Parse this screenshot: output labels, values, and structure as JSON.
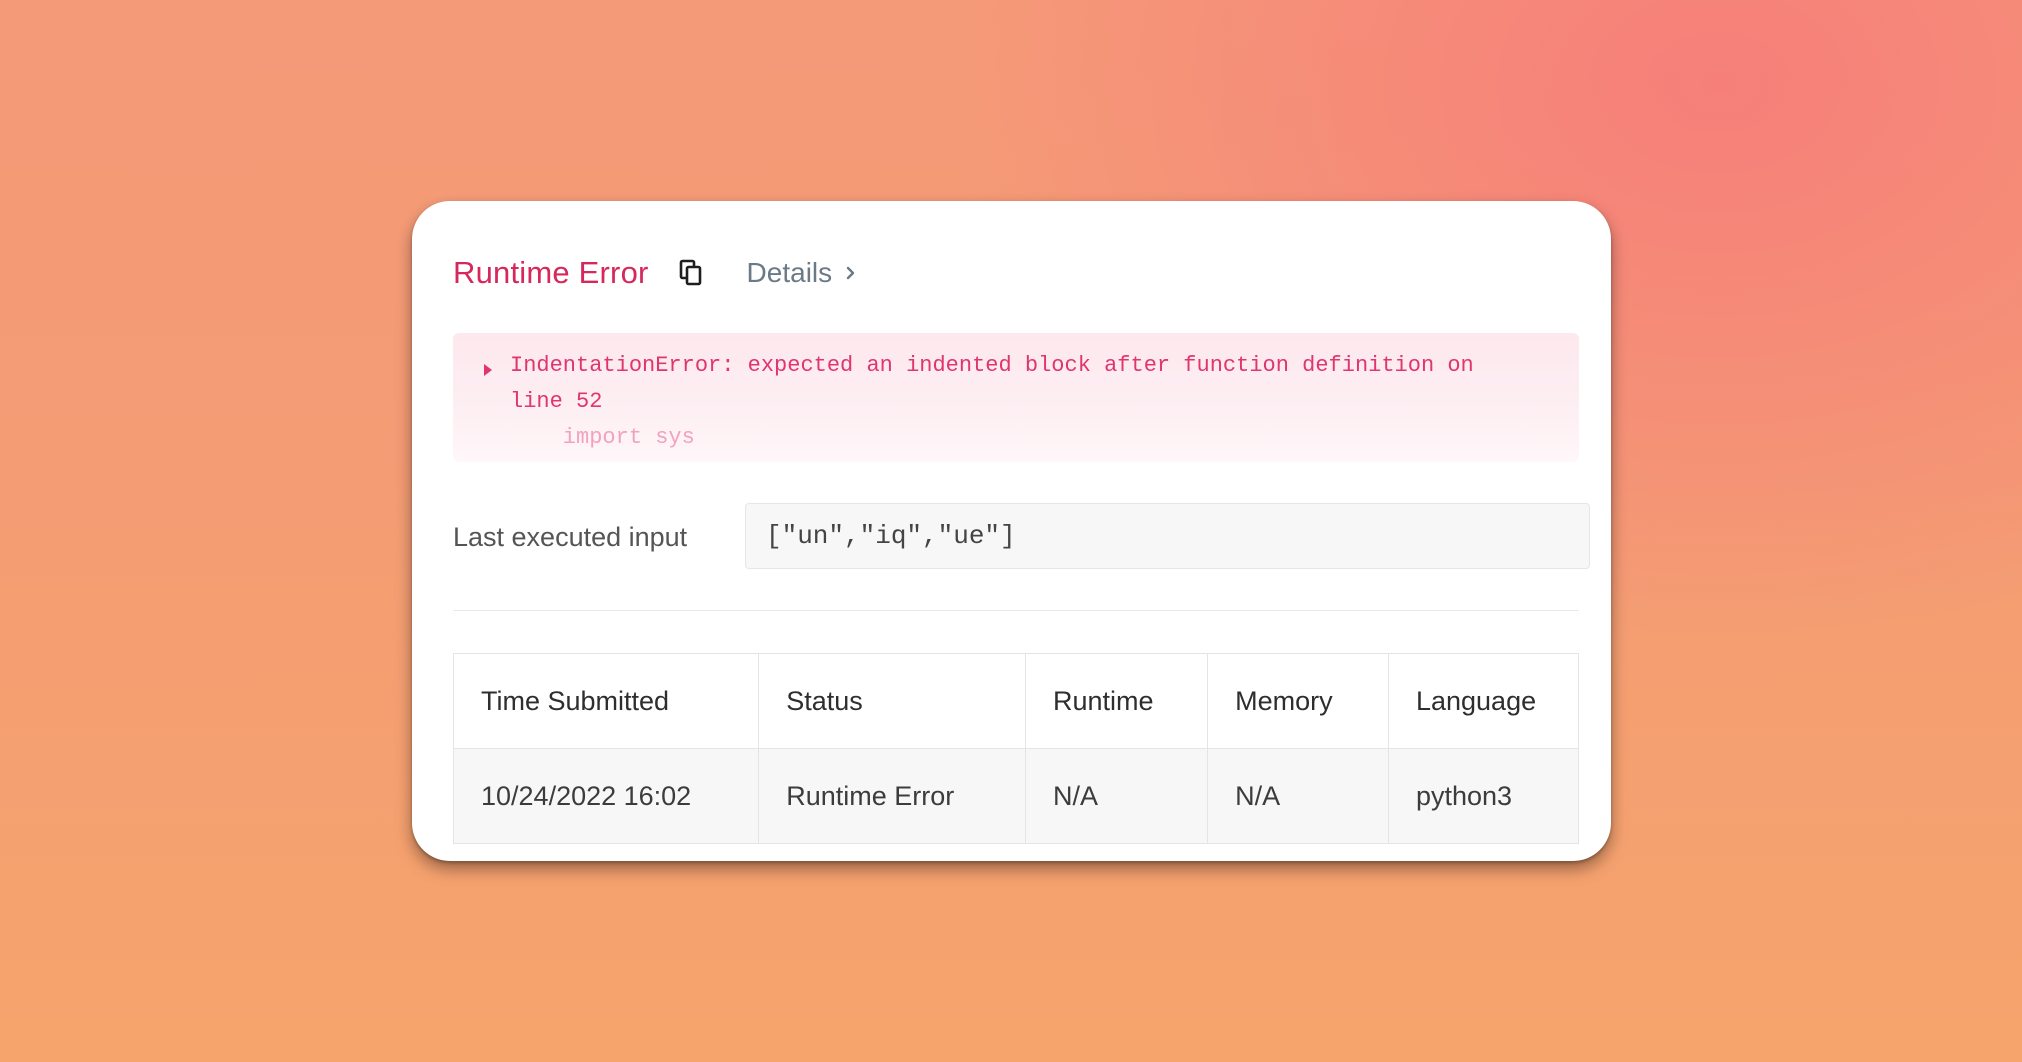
{
  "header": {
    "title": "Runtime Error",
    "copy_icon": "copy-icon",
    "details_label": "Details",
    "details_icon": "chevron-right-icon"
  },
  "error": {
    "toggle_icon": "caret-right-icon",
    "line1": "IndentationError: expected an indented block after function definition on",
    "line2": "line 52",
    "line3": "    import sys"
  },
  "last_input": {
    "label": "Last executed input",
    "value": "[\"un\",\"iq\",\"ue\"]"
  },
  "table": {
    "columns": [
      "Time Submitted",
      "Status",
      "Runtime",
      "Memory",
      "Language"
    ],
    "rows": [
      {
        "time": "10/24/2022 16:02",
        "status": "Runtime Error",
        "runtime": "N/A",
        "memory": "N/A",
        "language": "python3"
      }
    ]
  },
  "colors": {
    "error_title": "#d6285c",
    "error_text": "#e0356e",
    "status_error": "#d32f3f",
    "details_link": "#6b7a86"
  }
}
